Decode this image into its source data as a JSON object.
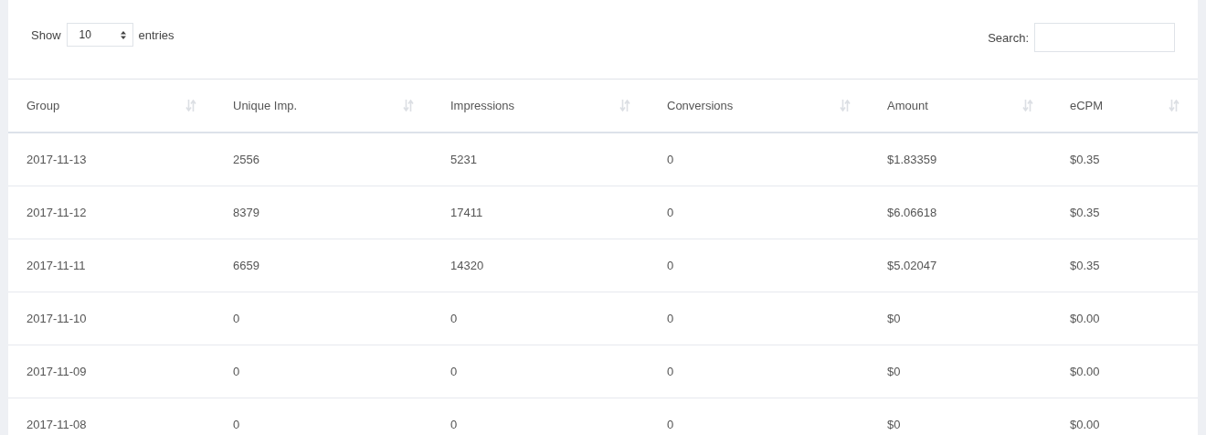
{
  "length_control": {
    "label_before": "Show",
    "value": "10",
    "label_after": "entries"
  },
  "search": {
    "label": "Search:"
  },
  "table": {
    "columns": [
      {
        "label": "Group"
      },
      {
        "label": "Unique Imp."
      },
      {
        "label": "Impressions"
      },
      {
        "label": "Conversions"
      },
      {
        "label": "Amount"
      },
      {
        "label": "eCPM"
      }
    ],
    "rows": [
      [
        "2017-11-13",
        "2556",
        "5231",
        "0",
        "$1.83359",
        "$0.35"
      ],
      [
        "2017-11-12",
        "8379",
        "17411",
        "0",
        "$6.06618",
        "$0.35"
      ],
      [
        "2017-11-11",
        "6659",
        "14320",
        "0",
        "$5.02047",
        "$0.35"
      ],
      [
        "2017-11-10",
        "0",
        "0",
        "0",
        "$0",
        "$0.00"
      ],
      [
        "2017-11-09",
        "0",
        "0",
        "0",
        "$0",
        "$0.00"
      ],
      [
        "2017-11-08",
        "0",
        "0",
        "0",
        "$0",
        "$0.00"
      ]
    ]
  }
}
